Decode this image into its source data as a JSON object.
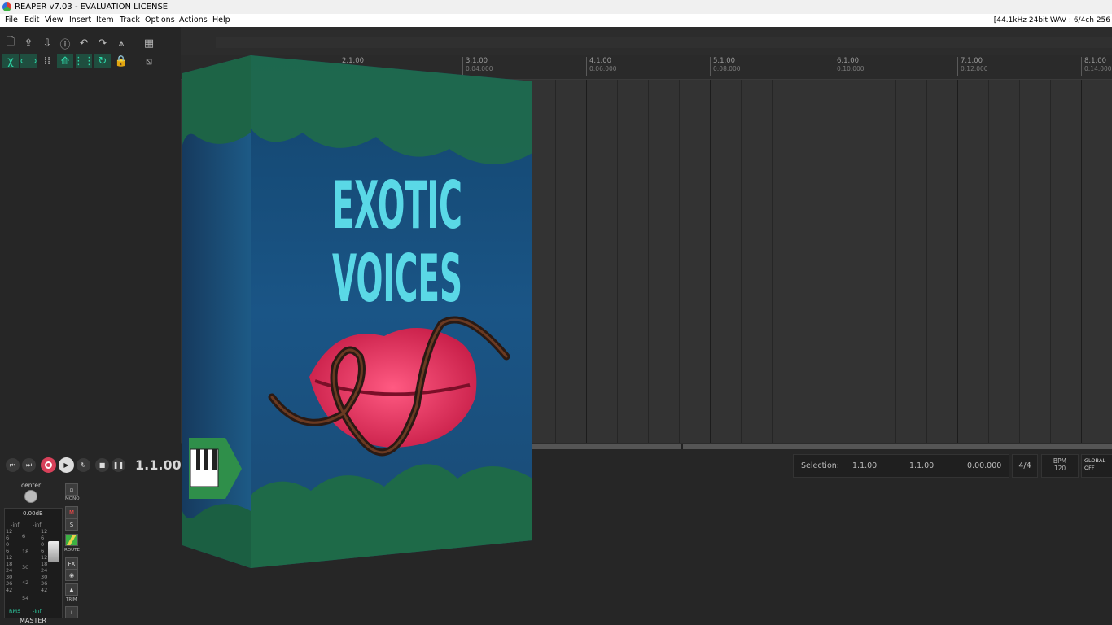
{
  "window": {
    "title": "REAPER v7.03 - EVALUATION LICENSE"
  },
  "menu": {
    "items": [
      "File",
      "Edit",
      "View",
      "Insert",
      "Item",
      "Track",
      "Options",
      "Actions",
      "Help"
    ],
    "status": "[44.1kHz 24bit WAV : 6/4ch 256"
  },
  "toolbar": {
    "row1_icons": [
      "new-project-icon",
      "open-project-icon",
      "save-project-icon",
      "project-settings-icon",
      "undo-icon",
      "redo-icon",
      "metronome-icon"
    ],
    "row2_icons": [
      "ripple-editing-icon",
      "grouping-icon",
      "grid-icon",
      "snap-icon",
      "grid-lines-icon",
      "loop-icon",
      "lock-icon"
    ]
  },
  "ruler": {
    "markers": [
      {
        "bar": "2.1.00",
        "time": ""
      },
      {
        "bar": "3.1.00",
        "time": "0:04.000"
      },
      {
        "bar": "4.1.00",
        "time": "0:06.000"
      },
      {
        "bar": "5.1.00",
        "time": "0:08.000"
      },
      {
        "bar": "6.1.00",
        "time": "0:10.000"
      },
      {
        "bar": "7.1.00",
        "time": "0:12.000"
      },
      {
        "bar": "8.1.00",
        "time": "0:14.000"
      }
    ]
  },
  "transport": {
    "position": "1.1.00",
    "buttons": [
      "go-to-start",
      "go-to-end",
      "record",
      "play",
      "repeat",
      "stop",
      "pause"
    ],
    "selection_label": "Selection:",
    "selection_start": "1.1.00",
    "selection_end": "1.1.00",
    "selection_length": "0.00.000",
    "time_signature": "4/4",
    "bpm_label": "BPM",
    "bpm_value": "120",
    "global_label": "GLOBAL",
    "global_state": "OFF"
  },
  "master": {
    "pan_label": "center",
    "volume": "0.00dB",
    "peak_left": "-inf",
    "peak_right": "-inf",
    "scale_left": [
      "12",
      "6",
      "0",
      "6",
      "12",
      "18",
      "24",
      "30",
      "36",
      "42"
    ],
    "scale_mid": [
      "6",
      "18",
      "30",
      "42",
      "54"
    ],
    "scale_right": [
      "12",
      "6",
      "0",
      "6",
      "12",
      "18",
      "24",
      "30",
      "36",
      "42"
    ],
    "rms_label": "RMS",
    "rms_value": "-inf",
    "label": "MASTER",
    "buttons": {
      "mono": "MONO",
      "mute": "M",
      "solo": "S",
      "route": "ROUTE",
      "fx": "FX",
      "trim": "TRIM",
      "info": "i"
    }
  },
  "product": {
    "title_line1": "EXOTIC",
    "title_line2": "VOICES",
    "accent": "#5ad8e6",
    "lips": "#e0244f",
    "water": "#1a4f82"
  }
}
